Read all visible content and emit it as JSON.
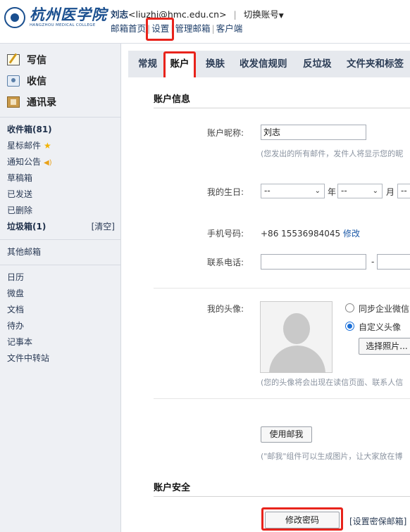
{
  "header": {
    "logo_cn": "杭州医学院",
    "logo_en": "HANGZHOU MEDICAL COLLEGE",
    "user_name": "刘志",
    "user_email": "<liuzhi@hmc.edu.cn>",
    "switch_account": "切换账号",
    "nav": [
      "邮箱首页",
      "设置",
      "管理邮箱",
      "客户端"
    ]
  },
  "sidebar": {
    "compose": "写信",
    "receive": "收信",
    "contacts": "通讯录",
    "folders": [
      "收件箱(81)",
      "星标邮件",
      "通知公告",
      "草稿箱",
      "已发送",
      "已删除",
      "垃圾箱(1)"
    ],
    "clear": "[清空]",
    "other": "其他邮箱",
    "apps": [
      "日历",
      "微盘",
      "文档",
      "待办",
      "记事本",
      "文件中转站"
    ]
  },
  "tabs": [
    "常规",
    "账户",
    "换肤",
    "收发信规则",
    "反垃圾",
    "文件夹和标签"
  ],
  "account_info": {
    "section_title": "账户信息",
    "nickname_label": "账户昵称:",
    "nickname_value": "刘志",
    "nickname_hint": "(您发出的所有邮件，发件人将显示您的昵",
    "birthday_label": "我的生日:",
    "birthday_year": "--",
    "year_unit": "年",
    "birthday_month": "--",
    "month_unit": "月",
    "birthday_day": "--",
    "mobile_label": "手机号码:",
    "mobile_value": "+86 15536984045",
    "mobile_edit": "修改",
    "phone_label": "联系电话:",
    "phone_dash": "-",
    "avatar_label": "我的头像:",
    "avatar_option_sync": "同步企业微信",
    "avatar_option_custom": "自定义头像",
    "choose_photo": "选择照片...",
    "avatar_hint": "(您的头像将会出现在读信页面、联系人信",
    "use_mail_button": "使用邮我",
    "mail_me_hint": "(\"邮我\"组件可以生成图片，让大家放在博"
  },
  "account_security": {
    "section_title": "账户安全",
    "change_password": "修改密码",
    "set_security_email": "[设置密保邮箱]"
  },
  "colors": {
    "highlight": "#e8231b",
    "brand": "#1a4f8f",
    "link": "#1d5aa8"
  }
}
